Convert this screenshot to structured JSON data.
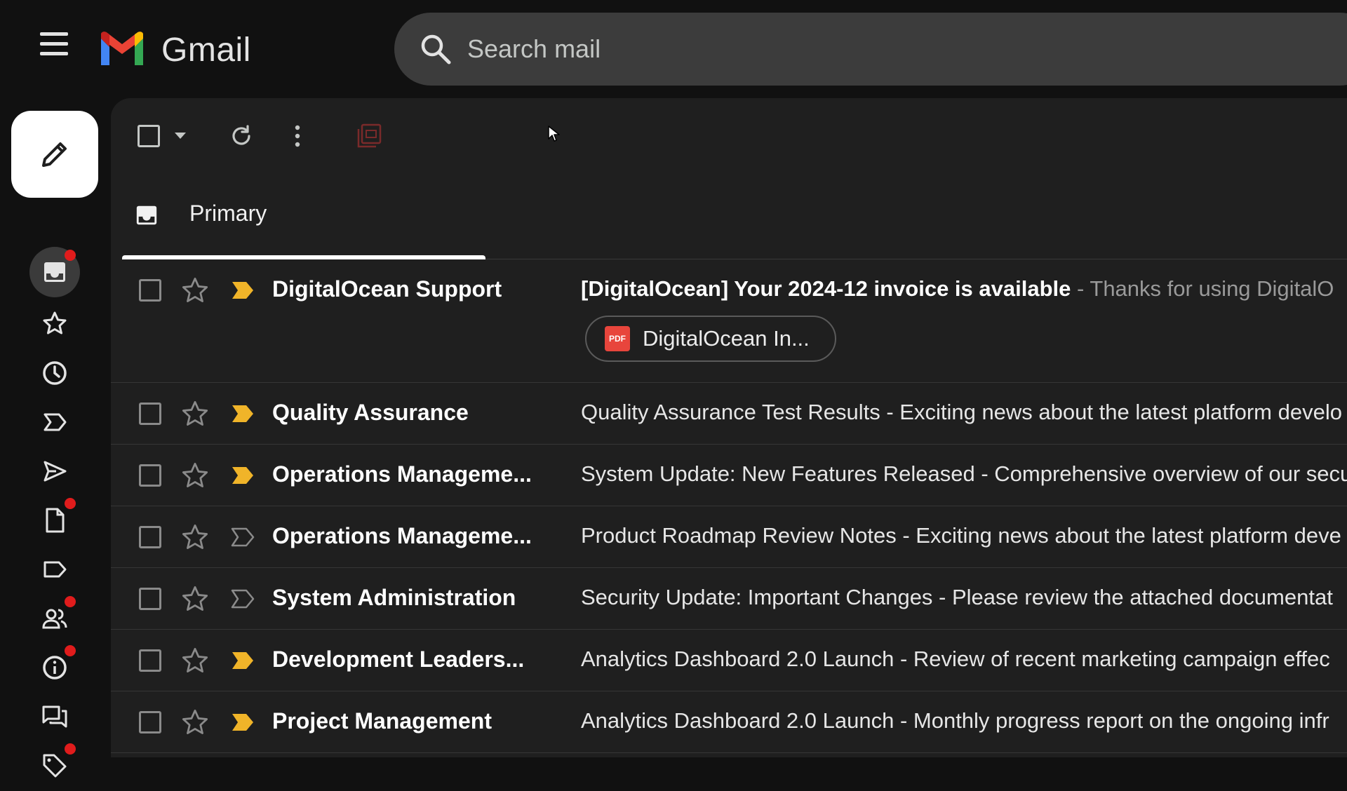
{
  "app": {
    "name": "Gmail"
  },
  "search": {
    "placeholder": "Search mail"
  },
  "tabs": [
    {
      "label": "Primary",
      "active": true
    }
  ],
  "colors": {
    "important": "#f0b429",
    "pdf": "#e8453c",
    "badge": "#e01c1c"
  },
  "nav": [
    {
      "icon": "inbox-icon",
      "active": true,
      "badge": true
    },
    {
      "icon": "star-icon",
      "badge": false
    },
    {
      "icon": "clock-icon",
      "badge": false
    },
    {
      "icon": "important-icon",
      "badge": false
    },
    {
      "icon": "send-icon",
      "badge": false
    },
    {
      "icon": "file-icon",
      "badge": true
    },
    {
      "icon": "label-icon",
      "badge": false
    },
    {
      "icon": "people-icon",
      "badge": true
    },
    {
      "icon": "info-icon",
      "badge": true
    },
    {
      "icon": "chat-icon",
      "badge": false
    },
    {
      "icon": "tag-icon",
      "badge": true
    }
  ],
  "emails": [
    {
      "sender": "DigitalOcean Support",
      "subject": "[DigitalOcean] Your 2024-12 invoice is available",
      "snippet": " - Thanks for using DigitalO",
      "unread": true,
      "important": true,
      "attachment": "DigitalOcean In..."
    },
    {
      "sender": "Quality Assurance",
      "subject": "Quality Assurance Test Results - Exciting news about the latest platform develo",
      "important": true
    },
    {
      "sender": "Operations Manageme...",
      "subject": "System Update: New Features Released - Comprehensive overview of our secu",
      "important": true
    },
    {
      "sender": "Operations Manageme...",
      "subject": "Product Roadmap Review Notes - Exciting news about the latest platform deve",
      "important": false
    },
    {
      "sender": "System Administration",
      "subject": "Security Update: Important Changes - Please review the attached documentat",
      "important": false
    },
    {
      "sender": "Development Leaders...",
      "subject": "Analytics Dashboard 2.0 Launch - Review of recent marketing campaign effec",
      "important": true
    },
    {
      "sender": "Project Management",
      "subject": "Analytics Dashboard 2.0 Launch - Monthly progress report on the ongoing infr",
      "important": true
    }
  ]
}
